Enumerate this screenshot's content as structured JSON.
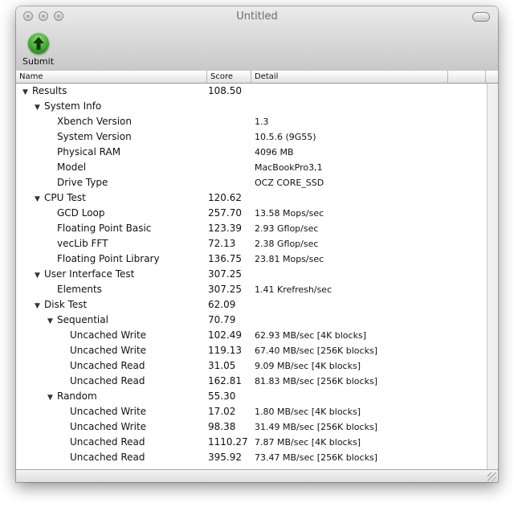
{
  "window": {
    "title": "Untitled"
  },
  "toolbar": {
    "submit_label": "Submit"
  },
  "columns": {
    "name": "Name",
    "score": "Score",
    "detail": "Detail"
  },
  "rows": [
    {
      "name": "Results",
      "score": "108.50",
      "detail": ""
    },
    {
      "name": "System Info",
      "score": "",
      "detail": ""
    },
    {
      "name": "Xbench Version",
      "score": "",
      "detail": "1.3"
    },
    {
      "name": "System Version",
      "score": "",
      "detail": "10.5.6 (9G55)"
    },
    {
      "name": "Physical RAM",
      "score": "",
      "detail": "4096 MB"
    },
    {
      "name": "Model",
      "score": "",
      "detail": "MacBookPro3,1"
    },
    {
      "name": "Drive Type",
      "score": "",
      "detail": "OCZ CORE_SSD"
    },
    {
      "name": "CPU Test",
      "score": "120.62",
      "detail": ""
    },
    {
      "name": "GCD Loop",
      "score": "257.70",
      "detail": "13.58 Mops/sec"
    },
    {
      "name": "Floating Point Basic",
      "score": "123.39",
      "detail": "2.93 Gflop/sec"
    },
    {
      "name": "vecLib FFT",
      "score": "72.13",
      "detail": "2.38 Gflop/sec"
    },
    {
      "name": "Floating Point Library",
      "score": "136.75",
      "detail": "23.81 Mops/sec"
    },
    {
      "name": "User Interface Test",
      "score": "307.25",
      "detail": ""
    },
    {
      "name": "Elements",
      "score": "307.25",
      "detail": "1.41 Krefresh/sec"
    },
    {
      "name": "Disk Test",
      "score": "62.09",
      "detail": ""
    },
    {
      "name": "Sequential",
      "score": "70.79",
      "detail": ""
    },
    {
      "name": "Uncached Write",
      "score": "102.49",
      "detail": "62.93 MB/sec [4K blocks]"
    },
    {
      "name": "Uncached Write",
      "score": "119.13",
      "detail": "67.40 MB/sec [256K blocks]"
    },
    {
      "name": "Uncached Read",
      "score": "31.05",
      "detail": "9.09 MB/sec [4K blocks]"
    },
    {
      "name": "Uncached Read",
      "score": "162.81",
      "detail": "81.83 MB/sec [256K blocks]"
    },
    {
      "name": "Random",
      "score": "55.30",
      "detail": ""
    },
    {
      "name": "Uncached Write",
      "score": "17.02",
      "detail": "1.80 MB/sec [4K blocks]"
    },
    {
      "name": "Uncached Write",
      "score": "98.38",
      "detail": "31.49 MB/sec [256K blocks]"
    },
    {
      "name": "Uncached Read",
      "score": "1110.27",
      "detail": "7.87 MB/sec [4K blocks]"
    },
    {
      "name": "Uncached Read",
      "score": "395.92",
      "detail": "73.47 MB/sec [256K blocks]"
    }
  ],
  "icons": {
    "submit": "green-up-arrow-icon",
    "expanded": "disclosure-triangle-down-icon"
  }
}
